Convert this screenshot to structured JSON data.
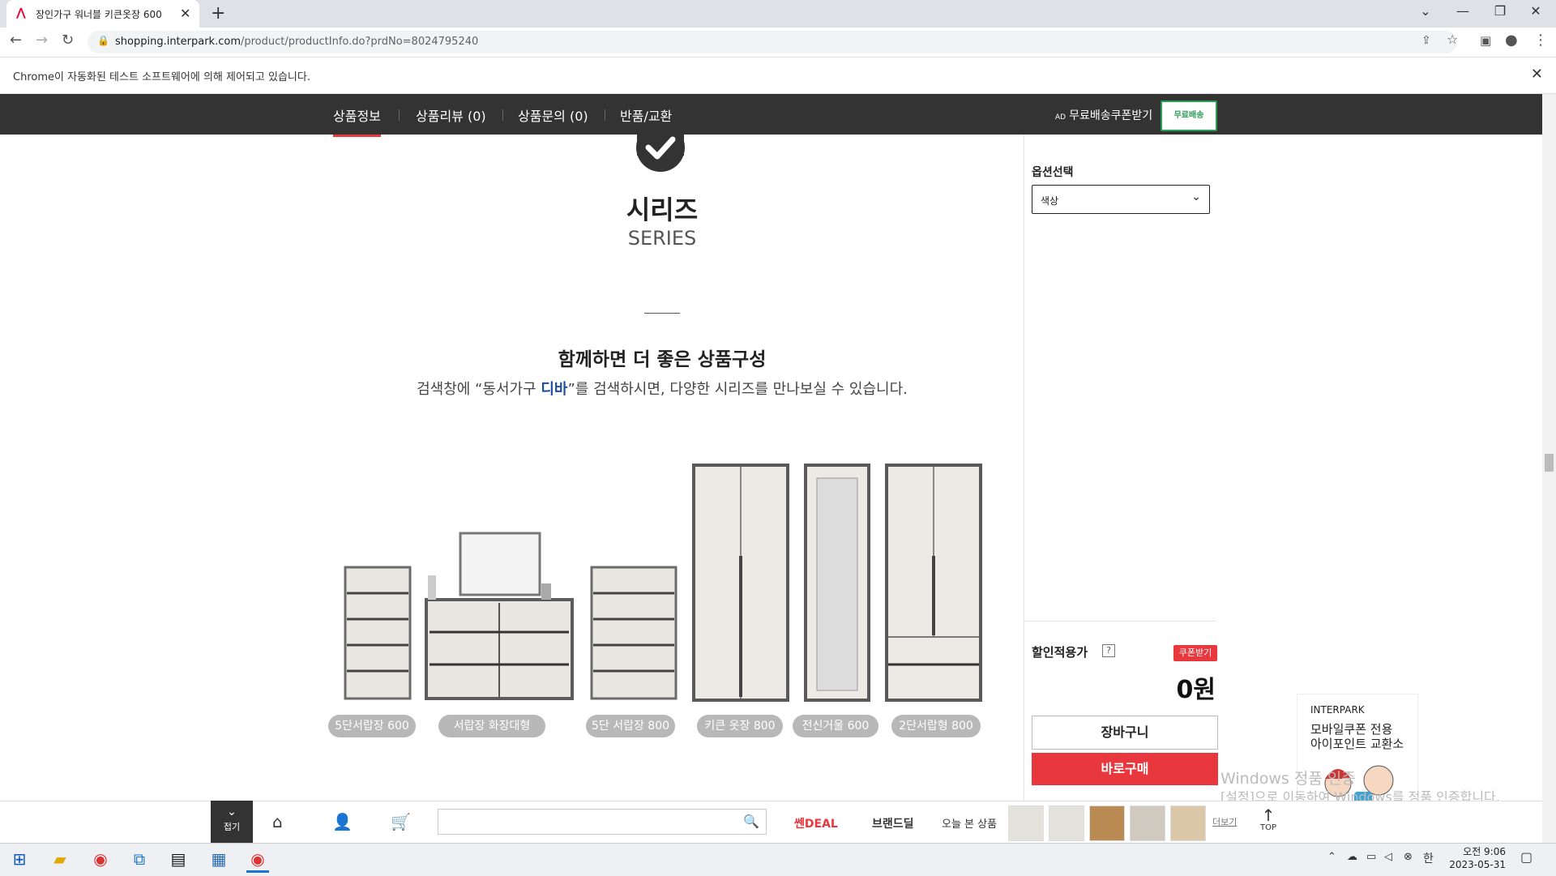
{
  "browser": {
    "tab_title": "장인가구 워너블 키큰옷장 600 ",
    "tab_close": "✕",
    "new_tab": "+",
    "url_host": "shopping.interpark.com",
    "url_path": "/product/productInfo.do?prdNo=8024795240",
    "infobar_text": "Chrome이 자동화된 테스트 소프트웨어에 의해 제어되고 있습니다.",
    "window_controls": [
      "⌄",
      "—",
      "❐",
      "✕"
    ]
  },
  "site_nav": {
    "tabs": [
      {
        "label": "상품정보",
        "active": true
      },
      {
        "label": "상품리뷰 (0)",
        "active": false
      },
      {
        "label": "상품문의 (0)",
        "active": false
      },
      {
        "label": "반품/교환",
        "active": false
      }
    ],
    "ad_tag": "AD",
    "coupon_text": "무료배송쿠폰받기",
    "free_shipping": "무료배송"
  },
  "content": {
    "series_kr": "시리즈",
    "series_en": "SERIES",
    "headline": "함께하면 더 좋은 상품구성",
    "sub_pre": "검색창에 “동서가구 ",
    "sub_hl": "디바",
    "sub_post": "”를 검색하시면, 다양한 시리즈를 만나보실 수 있습니다.",
    "products": [
      "5단서랍장 600",
      "서랍장 화장대형",
      "5단 서랍장 800",
      "키큰 옷장 800",
      "전신거울 600",
      "2단서랍형 800"
    ]
  },
  "panel": {
    "option_label": "옵션선택",
    "option_value": "색상",
    "discount_label": "할인적용가",
    "help": "?",
    "coupon_button": "쿠폰받기",
    "price": "0원",
    "cart_button": "장바구니",
    "buy_button": "바로구매"
  },
  "promo": {
    "brand": "INTERPARK",
    "line1": "모바일쿠폰 전용",
    "line2": "아이포인트 교환소"
  },
  "watermark": {
    "line1": "Windows 정품 인증",
    "line2": "[설정]으로 이동하여 Windows를 정품 인증합니다."
  },
  "bottom_bar": {
    "fold": "접기",
    "deal1": "쎈DEAL",
    "deal2": "브랜드딜",
    "recent": "오늘 본 상품",
    "more": "더보기",
    "top": "TOP"
  },
  "taskbar": {
    "time": "오전 9:06",
    "date": "2023-05-31",
    "ime": "한"
  },
  "colors": {
    "accent_red": "#e8373d",
    "nav_dark": "#333333",
    "free_green": "#2a9d54"
  }
}
